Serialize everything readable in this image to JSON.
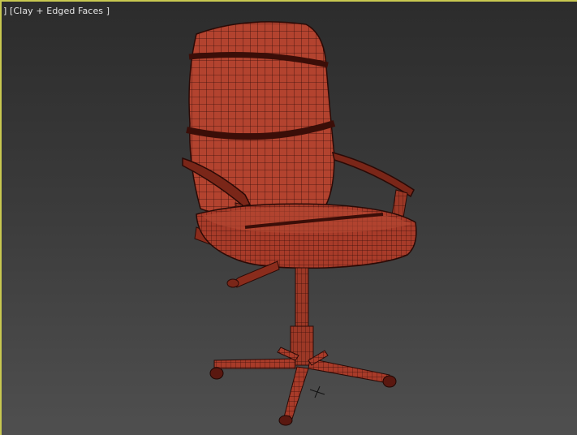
{
  "viewport": {
    "label": "] [Clay + Edged Faces ]",
    "border_color": "#c8c850",
    "background_top": "#2c2c2c",
    "background_bottom": "#4f4f4f"
  },
  "model": {
    "object": "office-chair",
    "shading": "Clay + Edged Faces",
    "clay_color": "#b0412f",
    "edge_color": "#3a0f0a"
  }
}
